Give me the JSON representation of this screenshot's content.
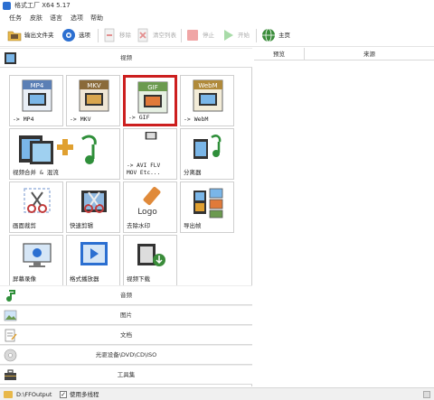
{
  "window": {
    "title": "格式工厂 X64 5.17"
  },
  "menu": [
    "任务",
    "皮肤",
    "语言",
    "选项",
    "帮助"
  ],
  "toolbar": {
    "output_folder": "输出文件夹",
    "options": "选项",
    "remove": "移除",
    "clear_list": "清空列表",
    "stop": "停止",
    "start": "开始",
    "home": "主页"
  },
  "categories": {
    "video": "视频",
    "audio": "音频",
    "image": "图片",
    "document": "文档",
    "optical": "光驱设备\\DVD\\CD\\ISO",
    "toolbox": "工具集"
  },
  "tiles": [
    {
      "label": "-> MP4",
      "badge": "MP4",
      "icon": "mp4-file-icon"
    },
    {
      "label": "-> MKV",
      "badge": "MKV",
      "icon": "mkv-file-icon"
    },
    {
      "label": "-> GIF",
      "badge": "GIF",
      "icon": "gif-file-icon"
    },
    {
      "label": "-> WebM",
      "badge": "WebM",
      "icon": "webm-file-icon"
    },
    {
      "label": "视频合并 & 混流",
      "icon": "video-merge-icon"
    },
    {
      "label": "-> AVI FLV\nMOV Etc...",
      "icon": "avi-film-icon"
    },
    {
      "label": "分离器",
      "icon": "splitter-icon"
    },
    {
      "label": "画面裁剪",
      "icon": "crop-icon"
    },
    {
      "label": "快速剪辑",
      "icon": "quick-cut-icon"
    },
    {
      "label": "去除水印",
      "badge": "Logo",
      "icon": "remove-watermark-icon"
    },
    {
      "label": "导出帧",
      "icon": "export-frames-icon"
    },
    {
      "label": "屏幕录像",
      "icon": "screen-record-icon"
    },
    {
      "label": "格式播放器",
      "icon": "player-icon"
    },
    {
      "label": "视频下载",
      "icon": "video-download-icon"
    }
  ],
  "right_panel": {
    "col_preview": "预览",
    "col_source": "来源"
  },
  "status": {
    "output_path": "D:\\FFOutput",
    "multithread_checked": true,
    "multithread_label": "使用多线程"
  },
  "colors": {
    "selection_border": "#cc1f1f",
    "accent_blue": "#2b6fd1"
  }
}
